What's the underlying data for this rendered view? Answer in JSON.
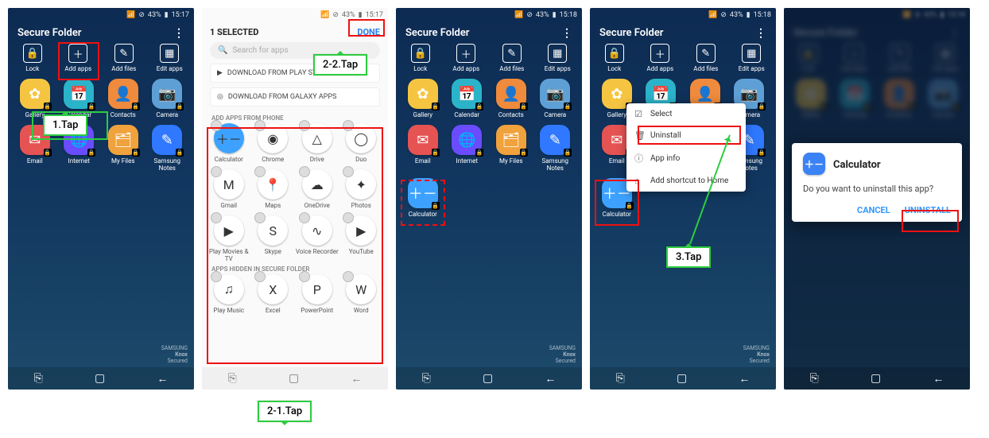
{
  "status": {
    "wifi": "▾",
    "signal": "◢",
    "alarm": "⊘",
    "battery": "43%",
    "t17": "15:17",
    "t18": "15:18"
  },
  "sf_title": "Secure Folder",
  "toolbar": {
    "lock": "Lock",
    "add_apps": "Add apps",
    "add_files": "Add files",
    "edit_apps": "Edit apps"
  },
  "apps_main": [
    {
      "k": "gallery",
      "label": "Gallery",
      "bg": "#f5c542",
      "glyph": "✿"
    },
    {
      "k": "calendar",
      "label": "Calendar",
      "bg": "#2bb3c9",
      "glyph": "📅"
    },
    {
      "k": "contacts",
      "label": "Contacts",
      "bg": "#f08a3c",
      "glyph": "👤"
    },
    {
      "k": "camera",
      "label": "Camera",
      "bg": "#5ea0d6",
      "glyph": "📷"
    },
    {
      "k": "email",
      "label": "Email",
      "bg": "#e55353",
      "glyph": "✉"
    },
    {
      "k": "internet",
      "label": "Internet",
      "bg": "#6a4cff",
      "glyph": "🌐"
    },
    {
      "k": "myfiles",
      "label": "My Files",
      "bg": "#f0a23c",
      "glyph": "🗂"
    },
    {
      "k": "notes",
      "label": "Samsung Notes",
      "bg": "#2f78ff",
      "glyph": "✎"
    }
  ],
  "calc": {
    "k": "calculator",
    "label": "Calculator",
    "bg": "#3da2ff",
    "glyph": "＋－"
  },
  "knox": {
    "brand": "SAMSUNG",
    "name": "Knox",
    "tag": "Secured"
  },
  "s2": {
    "header": "1 SELECTED",
    "done": "DONE",
    "search_ph": "Search for apps",
    "dl_play": "DOWNLOAD FROM PLAY STORE",
    "dl_galaxy": "DOWNLOAD FROM GALAXY APPS",
    "section1": "ADD APPS FROM PHONE",
    "section2": "APPS HIDDEN IN SECURE FOLDER",
    "phone_apps": [
      {
        "k": "calculator",
        "label": "Calculator",
        "bg": "#3da2ff",
        "glyph": "＋－"
      },
      {
        "k": "chrome",
        "label": "Chrome",
        "bg": "#fff",
        "glyph": "◉"
      },
      {
        "k": "drive",
        "label": "Drive",
        "bg": "#fff",
        "glyph": "△"
      },
      {
        "k": "duo",
        "label": "Duo",
        "bg": "#fff",
        "glyph": "◯"
      },
      {
        "k": "gmail",
        "label": "Gmail",
        "bg": "#fff",
        "glyph": "M"
      },
      {
        "k": "maps",
        "label": "Maps",
        "bg": "#fff",
        "glyph": "📍"
      },
      {
        "k": "onedrive",
        "label": "OneDrive",
        "bg": "#fff",
        "glyph": "☁"
      },
      {
        "k": "photos",
        "label": "Photos",
        "bg": "#fff",
        "glyph": "✦"
      },
      {
        "k": "playmovies",
        "label": "Play Movies & TV",
        "bg": "#fff",
        "glyph": "▶"
      },
      {
        "k": "skype",
        "label": "Skype",
        "bg": "#fff",
        "glyph": "S"
      },
      {
        "k": "voice",
        "label": "Voice Recorder",
        "bg": "#fff",
        "glyph": "∿"
      },
      {
        "k": "youtube",
        "label": "YouTube",
        "bg": "#fff",
        "glyph": "▶"
      }
    ],
    "hidden_apps": [
      {
        "k": "playmusic",
        "label": "Play Music",
        "bg": "#fff",
        "glyph": "♫"
      },
      {
        "k": "excel",
        "label": "Excel",
        "bg": "#fff",
        "glyph": "X"
      },
      {
        "k": "powerpoint",
        "label": "PowerPoint",
        "bg": "#fff",
        "glyph": "P"
      },
      {
        "k": "word",
        "label": "Word",
        "bg": "#fff",
        "glyph": "W"
      }
    ]
  },
  "ctx": {
    "select": "Select",
    "uninstall": "Uninstall",
    "appinfo": "App info",
    "shortcut": "Add shortcut to Home"
  },
  "dlg": {
    "title": "Calculator",
    "msg": "Do you want to uninstall this app?",
    "cancel": "CANCEL",
    "uninstall": "UNINSTALL"
  },
  "anno": {
    "step1": "1.Tap",
    "step21": "2-1.Tap",
    "step22": "2-2.Tap",
    "step3": "3.Tap"
  }
}
